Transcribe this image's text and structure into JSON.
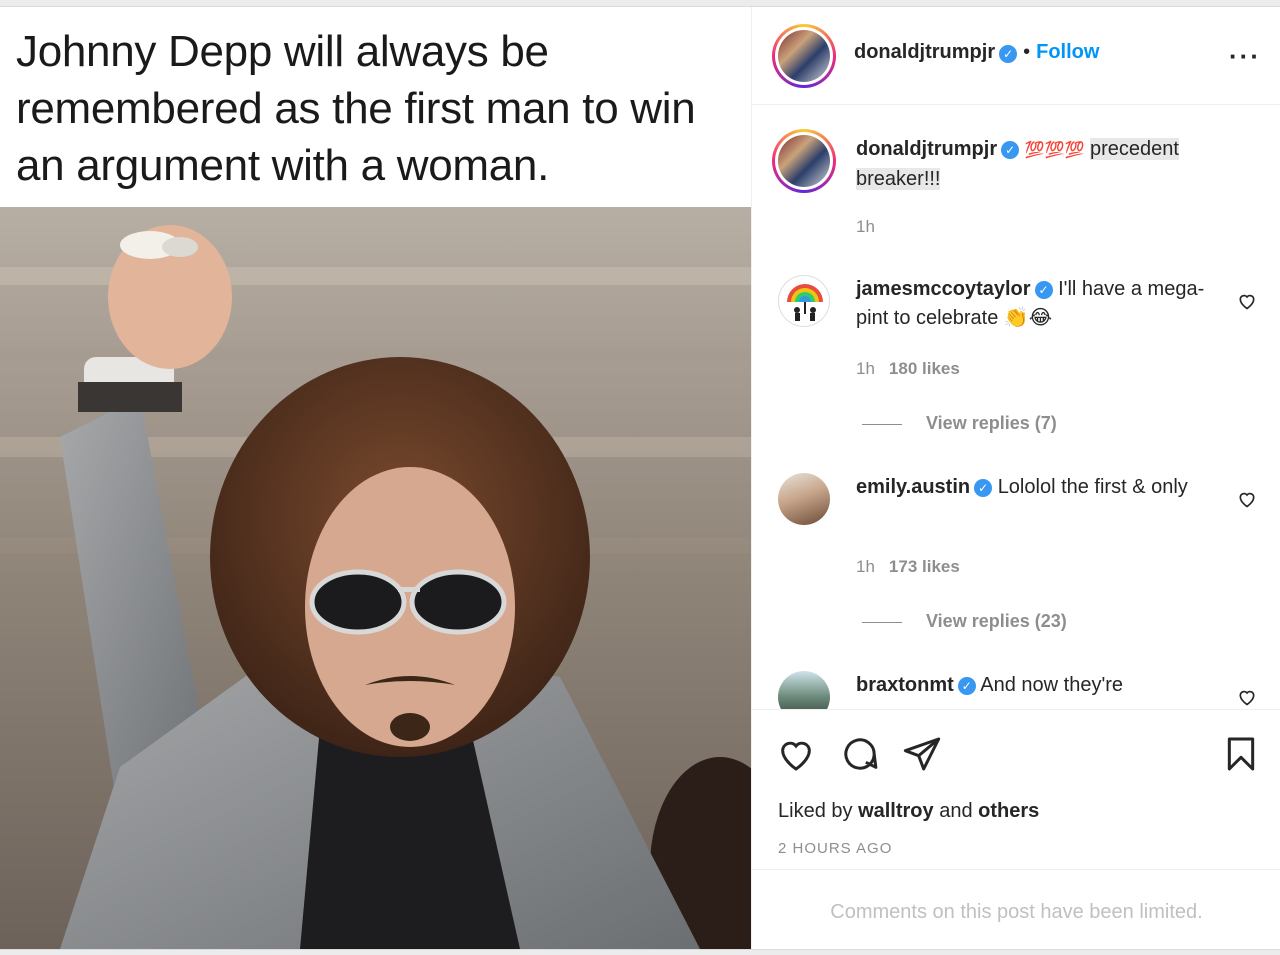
{
  "meme": {
    "caption": "Johnny Depp will always be remembered as the first man to win an argument with a woman."
  },
  "post": {
    "author": "donaldjtrumpjr",
    "separator": "•",
    "follow_label": "Follow",
    "more_label": "···",
    "caption_author": "donaldjtrumpjr",
    "caption_emoji": "💯💯💯",
    "caption_text": "precedent breaker!!!",
    "caption_time": "1h"
  },
  "comments": [
    {
      "user": "jamesmccoytaylor",
      "text": "I'll have a mega-pint to celebrate 👏😂",
      "time": "1h",
      "likes": "180 likes",
      "replies": "View replies (7)"
    },
    {
      "user": "emily.austin",
      "text": "Lololol the first & only",
      "time": "1h",
      "likes": "173 likes",
      "replies": "View replies (23)"
    },
    {
      "user": "braxtonmt",
      "text": "And now they're",
      "time": "",
      "likes": "",
      "replies": ""
    }
  ],
  "footer": {
    "liked_prefix": "Liked by",
    "liked_user": "walltroy",
    "liked_and": "and",
    "liked_others": "others",
    "timestamp": "2 HOURS AGO",
    "limited_notice": "Comments on this post have been limited."
  },
  "colors": {
    "link_blue": "#0095f6",
    "verified_blue": "#3897f0",
    "muted": "#8e8e8e"
  },
  "icons": [
    "heart-icon",
    "comment-icon",
    "share-icon",
    "bookmark-icon",
    "verified-icon",
    "more-icon"
  ]
}
